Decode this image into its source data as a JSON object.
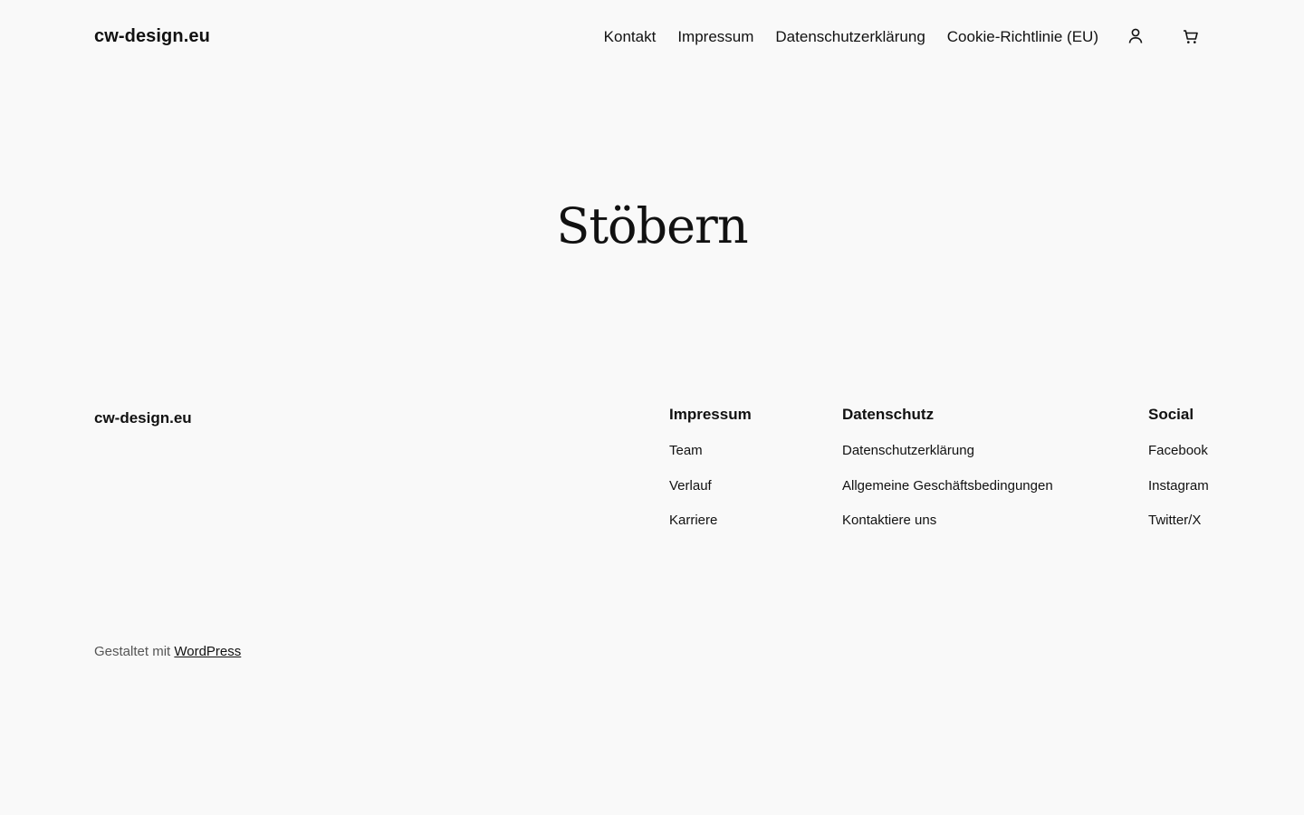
{
  "header": {
    "site_title": "cw-design.eu",
    "nav": [
      "Kontakt",
      "Impressum",
      "Datenschutzerklärung",
      "Cookie-Richtlinie (EU)"
    ],
    "icons": [
      "account-icon",
      "cart-icon"
    ]
  },
  "main": {
    "title": "Stöbern"
  },
  "footer": {
    "brand": "cw-design.eu",
    "columns": [
      {
        "heading": "Impressum",
        "links": [
          "Team",
          "Verlauf",
          "Karriere"
        ]
      },
      {
        "heading": "Datenschutz",
        "links": [
          "Datenschutzerklärung",
          "Allgemeine Geschäftsbedingungen",
          "Kontaktiere uns"
        ]
      },
      {
        "heading": "Social",
        "links": [
          "Facebook",
          "Instagram",
          "Twitter/X"
        ]
      }
    ],
    "credit_prefix": "Gestaltet mit ",
    "credit_link": "WordPress"
  },
  "colors": {
    "background": "#f9f9f9",
    "text": "#111111",
    "muted": "#555555"
  }
}
